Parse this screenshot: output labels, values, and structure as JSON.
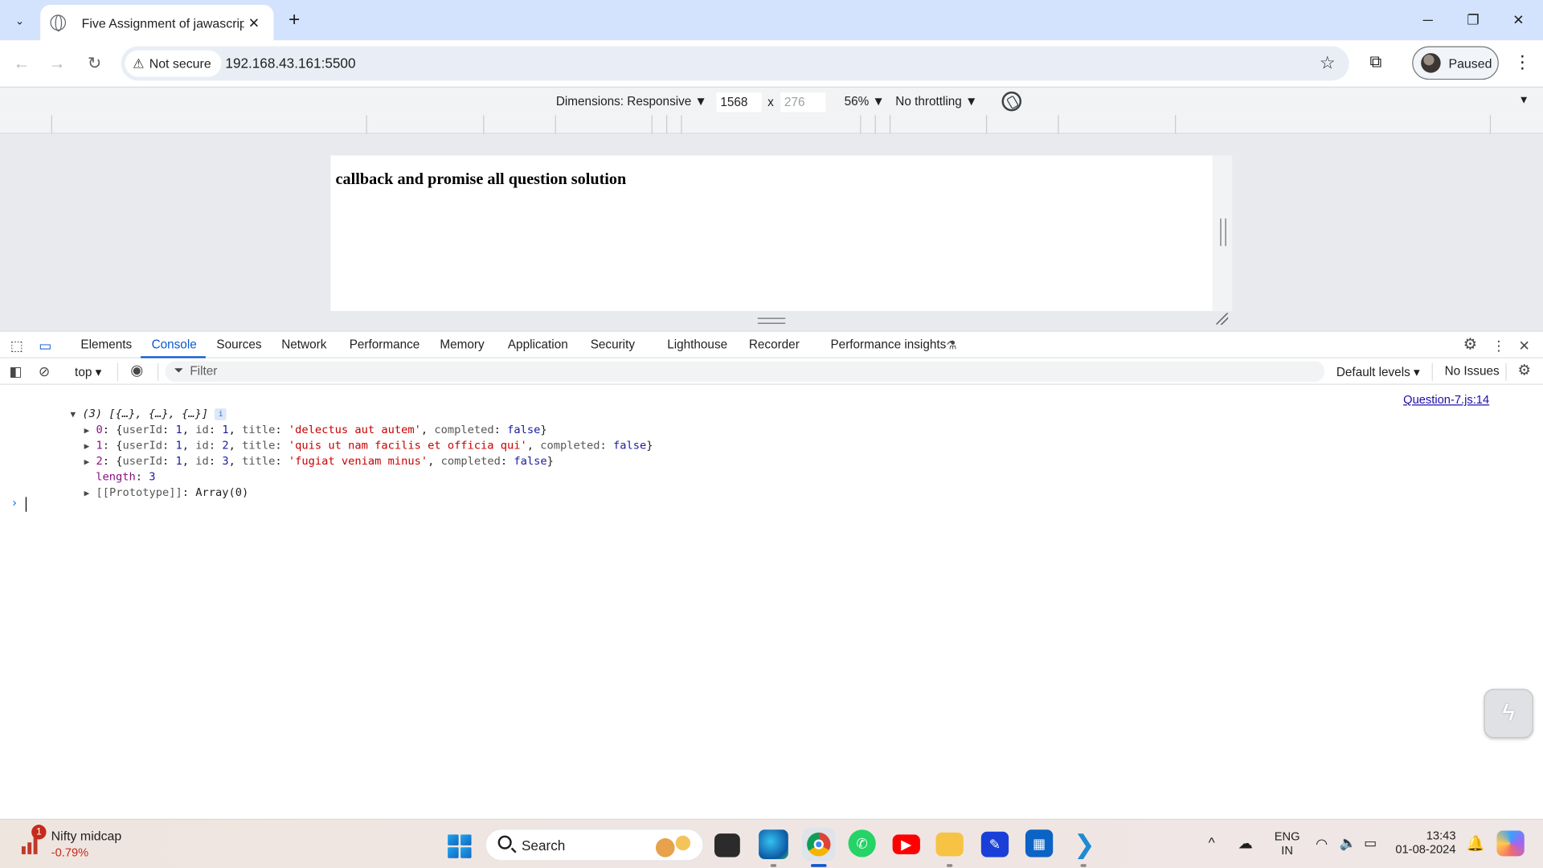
{
  "browser": {
    "tab_title": "Five Assignment of jawascript",
    "tab_list_icon": "chevron-down-icon",
    "security_label": "Not secure",
    "url": "192.168.43.161:5500",
    "profile_label": "Paused"
  },
  "device_toolbar": {
    "dimensions_label": "Dimensions: Responsive ▼",
    "width": "1568",
    "times": "x",
    "height": "276",
    "zoom": "56% ▼",
    "throttling": "No throttling ▼"
  },
  "page": {
    "heading": "callback and promise all question solution"
  },
  "devtools": {
    "tabs": [
      "Elements",
      "Console",
      "Sources",
      "Network",
      "Performance",
      "Memory",
      "Application",
      "Security",
      "Lighthouse",
      "Recorder",
      "Performance insights"
    ],
    "active_tab": "Console",
    "console_bar": {
      "context": "top",
      "filter_placeholder": "Filter",
      "levels": "Default levels",
      "issues": "No Issues"
    },
    "source_link": "Question-7.js:14",
    "log": {
      "summary": "(3) [{…}, {…}, {…}]",
      "items": [
        {
          "index": "0",
          "userId": "1",
          "id": "1",
          "title": "'delectus aut autem'",
          "completed": "false"
        },
        {
          "index": "1",
          "userId": "1",
          "id": "2",
          "title": "'quis ut nam facilis et officia qui'",
          "completed": "false"
        },
        {
          "index": "2",
          "userId": "1",
          "id": "3",
          "title": "'fugiat veniam minus'",
          "completed": "false"
        }
      ],
      "length_key": "length",
      "length_value": "3",
      "prototype_key": "[[Prototype]]",
      "prototype_value": "Array(0)"
    }
  },
  "taskbar": {
    "widget_badge": "1",
    "widget_name": "Nifty midcap",
    "widget_value": "-0.79%",
    "search_label": "Search",
    "lang_top": "ENG",
    "lang_bottom": "IN",
    "time": "13:43",
    "date": "01-08-2024"
  },
  "colors": {
    "accent": "#0b57d0",
    "tabstrip": "#d3e3fd",
    "string": "#c80000",
    "boolean": "#1a1aa6"
  }
}
